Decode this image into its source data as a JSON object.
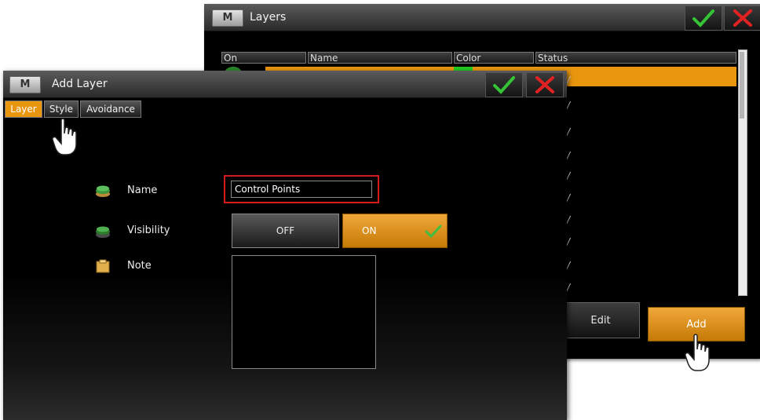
{
  "layers_window": {
    "logo": "M",
    "title": "Layers",
    "columns": [
      "On",
      "Name",
      "Color",
      "Status"
    ],
    "edit_label": "Edit",
    "add_label": "Add",
    "colors": {
      "accent": "#e8960e",
      "layer_color": "#22cc22"
    }
  },
  "add_layer_window": {
    "logo": "M",
    "title": "Add Layer",
    "tabs": [
      {
        "label": "Layer",
        "active": true
      },
      {
        "label": "Style",
        "active": false
      },
      {
        "label": "Avoidance",
        "active": false
      }
    ],
    "fields": {
      "name_label": "Name",
      "name_value": "Control Points",
      "visibility_label": "Visibility",
      "visibility_off": "OFF",
      "visibility_on": "ON",
      "visibility_selected": "ON",
      "note_label": "Note",
      "note_value": ""
    }
  }
}
